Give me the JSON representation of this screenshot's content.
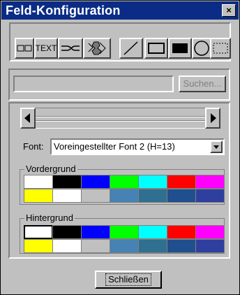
{
  "window": {
    "title": "Feld-Konfiguration",
    "close_glyph": "×"
  },
  "toolbar": {
    "tools": [
      {
        "name": "field-tool",
        "label": ""
      },
      {
        "name": "text-tool",
        "label": "TEXT"
      },
      {
        "name": "connector-tool",
        "label": ""
      },
      {
        "name": "image-tool",
        "label": ""
      },
      {
        "name": "line-tool",
        "label": ""
      },
      {
        "name": "rectangle-tool",
        "label": ""
      },
      {
        "name": "filled-rectangle-tool",
        "label": ""
      },
      {
        "name": "ellipse-tool",
        "label": ""
      },
      {
        "name": "filled-ellipse-tool",
        "label": ""
      },
      {
        "name": "selection-tool",
        "label": ""
      }
    ]
  },
  "search": {
    "value": "",
    "button_label": "Suchen..."
  },
  "font": {
    "label": "Font:",
    "selected": "Voreingestellter Font 2 (H=13)"
  },
  "foreground": {
    "label": "Vordergrund",
    "colors_row1": [
      "#ffffff",
      "#000000",
      "#0000ff",
      "#00ff00",
      "#00ffff",
      "#ff0000",
      "#ff00ff"
    ],
    "colors_row2": [
      "#ffff00",
      "#ffffff",
      "#c0c0c0",
      "#4682b4",
      "#2f6f8f",
      "#1f4f8f",
      "#2f3f9f"
    ]
  },
  "background": {
    "label": "Hintergrund",
    "colors_row1": [
      "#ffffff",
      "#000000",
      "#0000ff",
      "#00ff00",
      "#00ffff",
      "#ff0000",
      "#ff00ff"
    ],
    "colors_row2": [
      "#ffff00",
      "#ffffff",
      "#c0c0c0",
      "#4682b4",
      "#2f6f8f",
      "#1f4f8f",
      "#2f3f9f"
    ]
  },
  "footer": {
    "close_label": "Schließen"
  }
}
